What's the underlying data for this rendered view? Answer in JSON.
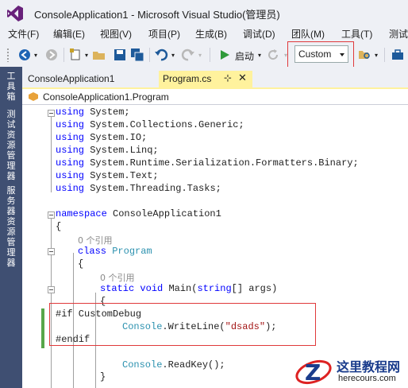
{
  "window": {
    "title": "ConsoleApplication1 - Microsoft Visual Studio(管理员)"
  },
  "menu": {
    "items": [
      "文件(F)",
      "编辑(E)",
      "视图(V)",
      "项目(P)",
      "生成(B)",
      "调试(D)",
      "团队(M)",
      "工具(T)",
      "测试"
    ]
  },
  "toolbar": {
    "start_label": "启动",
    "configuration": "Custom"
  },
  "side_panel": {
    "tabs": [
      "工具箱",
      "测试资源管理器",
      "服务器资源管理器"
    ]
  },
  "tabs": {
    "inactive": "ConsoleApplication1",
    "active": "Program.cs",
    "pin_icon": "⊹",
    "close_icon": "✕"
  },
  "navbar": {
    "scope": "ConsoleApplication1.Program"
  },
  "code": {
    "usings": [
      {
        "kw": "using",
        "ns": "System;"
      },
      {
        "kw": "using",
        "ns": "System.Collections.Generic;"
      },
      {
        "kw": "using",
        "ns": "System.IO;"
      },
      {
        "kw": "using",
        "ns": "System.Linq;"
      },
      {
        "kw": "using",
        "ns": "System.Runtime.Serialization.Formatters.Binary;"
      },
      {
        "kw": "using",
        "ns": "System.Text;"
      },
      {
        "kw": "using",
        "ns": "System.Threading.Tasks;"
      }
    ],
    "namespace_kw": "namespace",
    "namespace_name": "ConsoleApplication1",
    "open_brace": "{",
    "close_brace": "}",
    "ref_count_1": "0 个引用",
    "class_kw": "class",
    "class_name": "Program",
    "ref_count_2": "0 个引用",
    "method_kw_static": "static",
    "method_kw_void": "void",
    "method_name": "Main(",
    "method_param_kw": "string",
    "method_param_rest": "[] args)",
    "directive_if": "#if CustomDebug",
    "console_type": "Console",
    "writeline": ".WriteLine(",
    "string_literal": "\"dsads\"",
    "writeline_end": ");",
    "directive_endif": "#endif",
    "readkey": ".ReadKey();"
  },
  "watermark": {
    "title": "这里教程网",
    "url": "herecours.com"
  },
  "colors": {
    "keyword": "#0000ff",
    "type": "#2b91af",
    "string": "#a31515",
    "highlight_box": "#e0393b",
    "side_panel": "#3f4f72",
    "active_tab": "#fff29d"
  }
}
